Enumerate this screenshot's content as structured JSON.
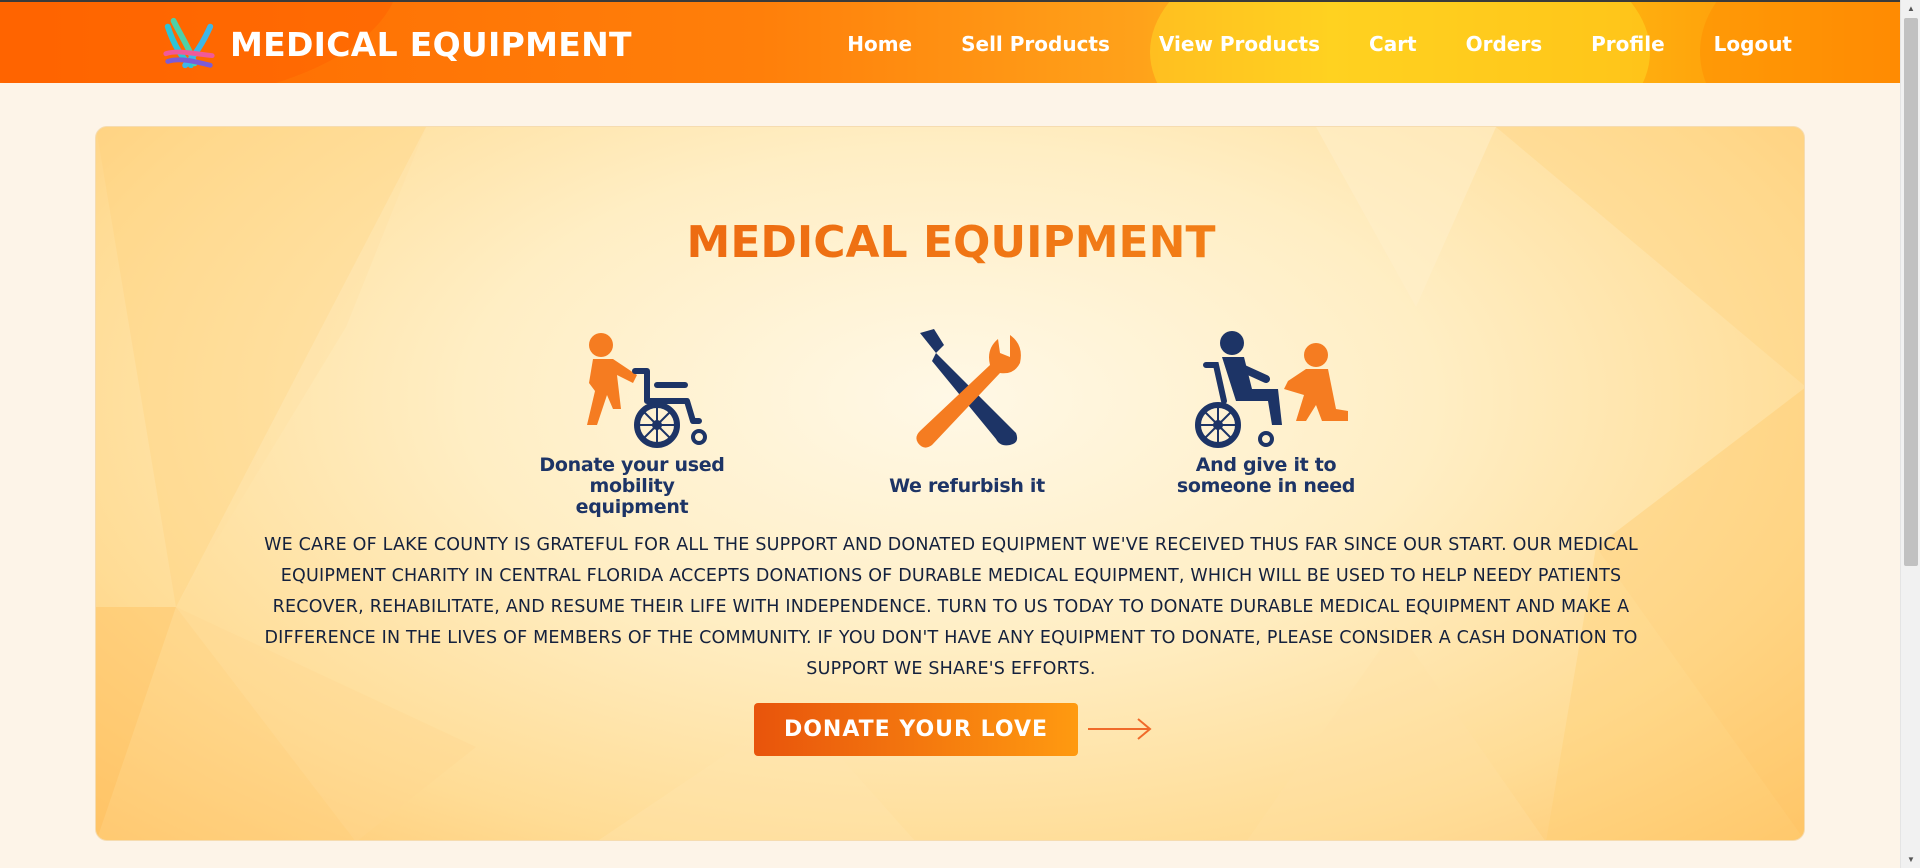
{
  "navbar": {
    "brand": "MEDICAL EQUIPMENT",
    "links": [
      "Home",
      "Sell Products",
      "View Products",
      "Cart",
      "Orders",
      "Profile",
      "Logout"
    ]
  },
  "hero": {
    "title": "MEDICAL EQUIPMENT",
    "steps": [
      {
        "icon": "wheelchair-donor-icon",
        "line1": "Donate your used",
        "line2": "mobility equipment"
      },
      {
        "icon": "wrench-screwdriver-icon",
        "line1": "We refurbish it",
        "line2": ""
      },
      {
        "icon": "wheelchair-receiver-icon",
        "line1": "And give it to",
        "line2": "someone in need"
      }
    ],
    "description": "WE CARE OF LAKE COUNTY IS GRATEFUL FOR ALL THE SUPPORT AND DONATED EQUIPMENT WE'VE RECEIVED THUS FAR SINCE OUR START. OUR MEDICAL EQUIPMENT CHARITY IN CENTRAL FLORIDA ACCEPTS DONATIONS OF DURABLE MEDICAL EQUIPMENT, WHICH WILL BE USED TO HELP NEEDY PATIENTS RECOVER, REHABILITATE, AND RESUME THEIR LIFE WITH INDEPENDENCE. TURN TO US TODAY TO DONATE DURABLE MEDICAL EQUIPMENT AND MAKE A DIFFERENCE IN THE LIVES OF MEMBERS OF THE COMMUNITY. IF YOU DON'T HAVE ANY EQUIPMENT TO DONATE, PLEASE CONSIDER A CASH DONATION TO SUPPORT WE SHARE'S EFFORTS.",
    "button_label": "DONATE YOUR LOVE"
  },
  "colors": {
    "nav_gradient_start": "#ff6a00",
    "nav_gradient_mid": "#ffc61a",
    "accent_orange": "#f57c21",
    "navy": "#1d3466",
    "page_bg": "#fdf4e8"
  }
}
